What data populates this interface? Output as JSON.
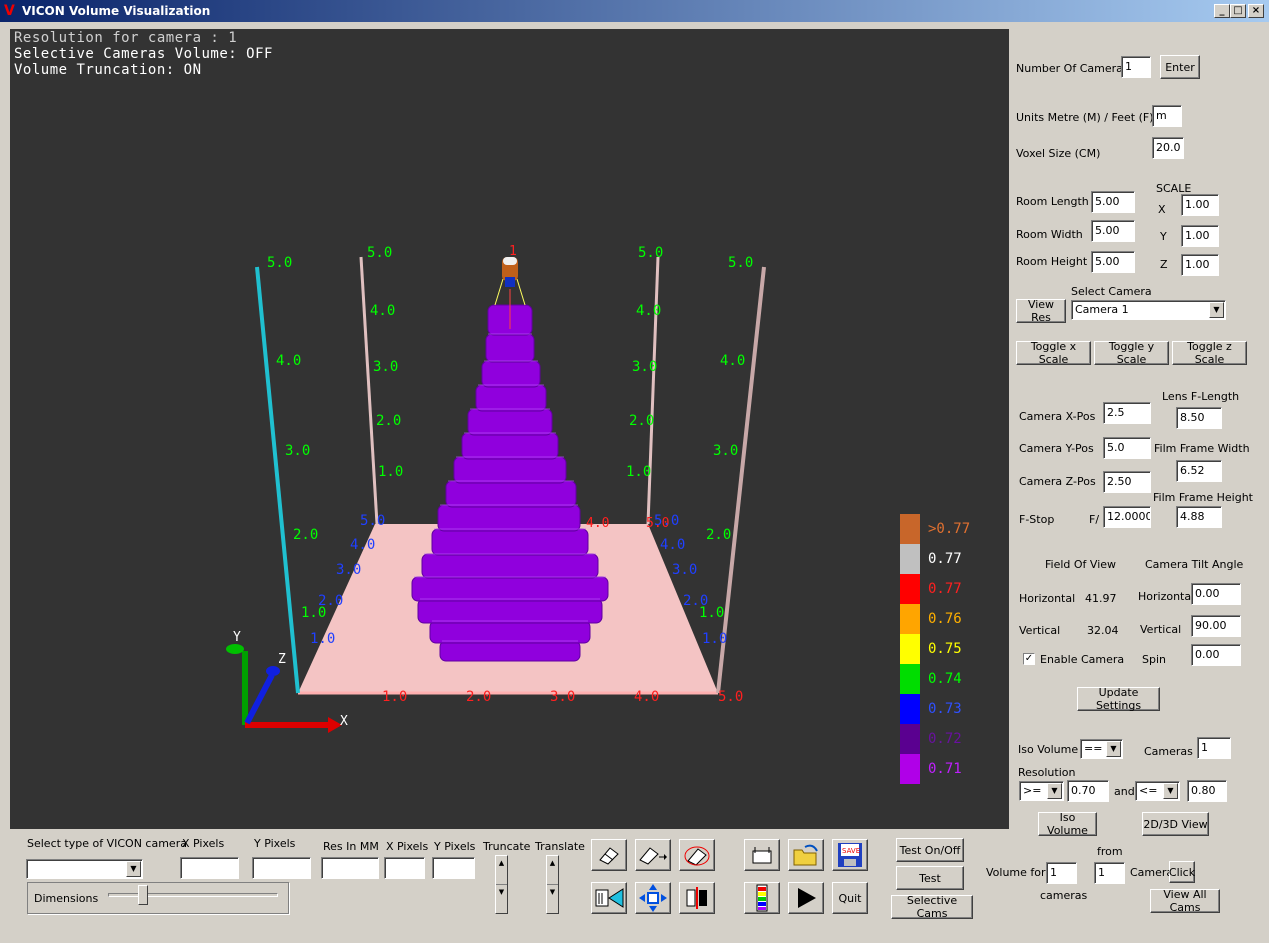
{
  "window": {
    "title": "VICON Volume Visualization",
    "min": "_",
    "max": "□",
    "close": "×"
  },
  "viewport": {
    "lines": [
      "Resolution for camera : 1",
      "Selective Cameras Volume: OFF",
      "Volume Truncation: ON"
    ],
    "axes": {
      "x": "X",
      "y": "Y",
      "z": "Z"
    },
    "pole_ticks": [
      "1.0",
      "2.0",
      "3.0",
      "4.0",
      "5.0"
    ],
    "floor_x_ticks": [
      "1.0",
      "2.0",
      "3.0",
      "4.0",
      "5.0"
    ],
    "floor_z_ticks": [
      "1.0",
      "2.0",
      "3.0",
      "4.0",
      "5.0"
    ],
    "camera_label": "1"
  },
  "legend": [
    {
      "color": "#c8662a",
      "label": ">0.77",
      "text_color": "#e07030"
    },
    {
      "color": "#c0c0c0",
      "label": "0.77",
      "text_color": "#ffffff"
    },
    {
      "color": "#ff0000",
      "label": "0.77",
      "text_color": "#ff2020"
    },
    {
      "color": "#ffa500",
      "label": "0.76",
      "text_color": "#ffb000"
    },
    {
      "color": "#ffff00",
      "label": "0.75",
      "text_color": "#ffff00"
    },
    {
      "color": "#00dd00",
      "label": "0.74",
      "text_color": "#00ff00"
    },
    {
      "color": "#0000ff",
      "label": "0.73",
      "text_color": "#3050ff"
    },
    {
      "color": "#5a0090",
      "label": "0.72",
      "text_color": "#6a10a0"
    },
    {
      "color": "#b000e8",
      "label": "0.71",
      "text_color": "#c020ff"
    }
  ],
  "panel": {
    "num_cameras_label": "Number Of Cameras",
    "num_cameras_value": "1",
    "enter": "Enter",
    "units_label": "Units Metre (M) / Feet (F)",
    "units_value": "m",
    "voxel_label": "Voxel Size (CM)",
    "voxel_value": "20.0",
    "scale_label": "SCALE",
    "room_length_label": "Room Length",
    "room_length": "5.00",
    "scale_x_label": "X",
    "scale_x": "1.00",
    "room_width_label": "Room Width",
    "room_width": "5.00",
    "scale_y_label": "Y",
    "scale_y": "1.00",
    "room_height_label": "Room Height",
    "room_height": "5.00",
    "scale_z_label": "Z",
    "scale_z": "1.00",
    "select_camera_label": "Select Camera",
    "view_res": "View Res",
    "camera_selected": "Camera 1",
    "toggle_x": "Toggle x Scale",
    "toggle_y": "Toggle y Scale",
    "toggle_z": "Toggle z Scale",
    "lens_label": "Lens F-Length",
    "lens_value": "8.50",
    "cam_x_label": "Camera X-Pos",
    "cam_x": "2.5",
    "cam_y_label": "Camera Y-Pos",
    "cam_y": "5.0",
    "film_w_label": "Film Frame Width",
    "film_w": "6.52",
    "cam_z_label": "Camera Z-Pos",
    "cam_z": "2.50",
    "film_h_label": "Film Frame Height",
    "film_h": "4.88",
    "fstop_label": "F-Stop",
    "fstop_prefix": "F/",
    "fstop_value": "12.0000",
    "fov_label": "Field Of View",
    "tilt_label": "Camera Tilt Angle",
    "horiz_label": "Horizontal",
    "horiz_fov": "41.97",
    "horiz_tilt_label": "Horizontal",
    "horiz_tilt": "0.00",
    "vert_label": "Vertical",
    "vert_fov": "32.04",
    "vert_tilt_label": "Vertical",
    "vert_tilt": "90.00",
    "enable_camera": "Enable Camera",
    "enable_checked": "✓",
    "spin_label": "Spin",
    "spin_value": "0.00",
    "update": "Update Settings",
    "iso_volume_label": "Iso Volume",
    "iso_op": "==",
    "cameras_label": "Cameras",
    "cameras_value": "1",
    "resolution_label": "Resolution",
    "res_op1": ">=",
    "res_val1": "0.70",
    "and_label": "and",
    "res_op2": "<=",
    "res_val2": "0.80",
    "iso_volume_btn": "Iso Volume",
    "view_2d3d": "2D/3D View"
  },
  "bottom": {
    "select_type_label": "Select type of VICON camera",
    "type_value": "",
    "xpix_label": "X Pixels",
    "ypix_label": "Y Pixels",
    "res_mm_label": "Res In MM",
    "xpix2_label": "X Pixels",
    "ypix2_label": "Y Pixels",
    "truncate_label": "Truncate",
    "translate_label": "Translate",
    "dimensions_label": "Dimensions",
    "quit": "Quit",
    "test_onoff": "Test On/Off",
    "test": "Test",
    "selective_cams": "Selective Cams",
    "volume_for_label": "Volume for",
    "volume_for_value": "1",
    "cameras_label": "cameras",
    "from_label": "from",
    "from_value": "1",
    "camera_label": "Camera",
    "click": "Click",
    "view_all_cams": "View All Cams",
    "save_text": "SAVE"
  }
}
